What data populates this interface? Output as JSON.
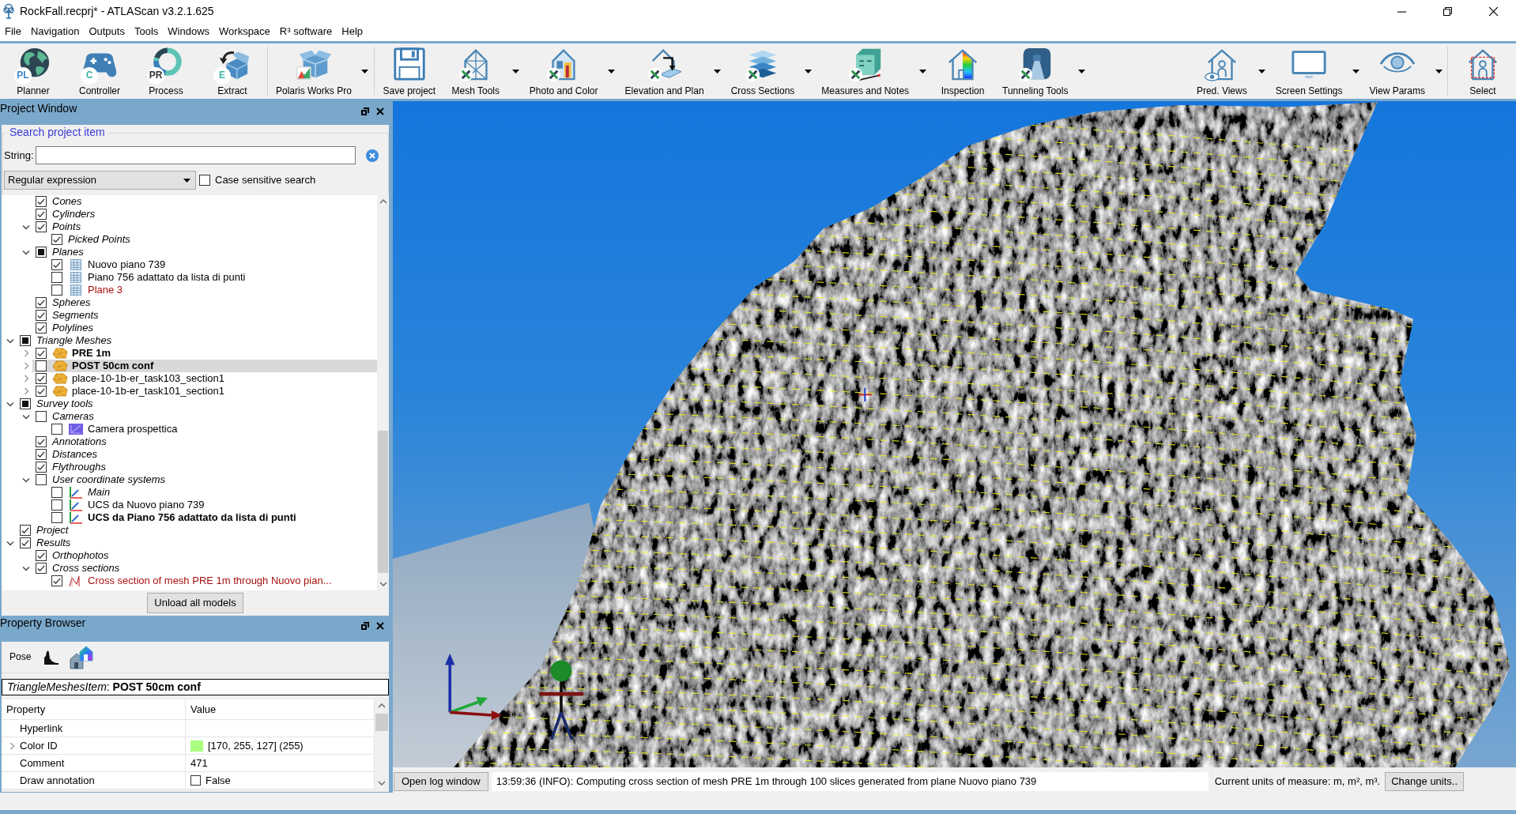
{
  "window": {
    "title": "RockFall.recprj* - ATLAScan v3.2.1.625"
  },
  "menu": [
    "File",
    "Navigation",
    "Outputs",
    "Tools",
    "Windows",
    "Workspace",
    "R³ software",
    "Help"
  ],
  "toolbar": {
    "left_groups": [
      {
        "items": [
          {
            "label": "Planner",
            "kind": "planner",
            "badge": "PL",
            "dropdown": false
          },
          {
            "label": "Controller",
            "kind": "controller",
            "badge": "C",
            "dropdown": false
          },
          {
            "label": "Process",
            "kind": "process",
            "badge": "PR",
            "dropdown": false
          },
          {
            "label": "Extract",
            "kind": "extract",
            "badge": "E",
            "dropdown": false
          }
        ]
      },
      {
        "items": [
          {
            "label": "Polaris Works Pro",
            "kind": "polaris",
            "dropdown": true
          }
        ]
      },
      {
        "items": [
          {
            "label": "Save project",
            "kind": "save",
            "dropdown": false
          },
          {
            "label": "Mesh Tools",
            "kind": "mesh",
            "dropdown": true
          },
          {
            "label": "Photo and Color",
            "kind": "photo",
            "dropdown": true
          },
          {
            "label": "Elevation and Plan",
            "kind": "elevation",
            "dropdown": true
          },
          {
            "label": "Cross Sections",
            "kind": "sections",
            "dropdown": true
          },
          {
            "label": "Measures and Notes",
            "kind": "measures",
            "dropdown": true
          },
          {
            "label": "Inspection",
            "kind": "inspection",
            "dropdown": false
          },
          {
            "label": "Tunneling Tools",
            "kind": "tunneling",
            "dropdown": true
          }
        ]
      }
    ],
    "right_groups": [
      {
        "items": [
          {
            "label": "Pred. Views",
            "kind": "predviews",
            "dropdown": true
          },
          {
            "label": "Screen Settings",
            "kind": "screen",
            "dropdown": true
          },
          {
            "label": "View Params",
            "kind": "viewparams",
            "dropdown": true
          }
        ]
      },
      {
        "items": [
          {
            "label": "Select",
            "kind": "select",
            "dropdown": false
          }
        ]
      }
    ]
  },
  "project_window": {
    "title": "Project Window",
    "search": {
      "title": "Search project item",
      "string_label": "String:",
      "mode": "Regular expression",
      "case_sensitive": {
        "label": "Case sensitive search",
        "checked": false
      }
    },
    "tree": [
      {
        "children": [
          {
            "label": "Cones",
            "italic": true,
            "checked": true,
            "selected": false
          },
          {
            "label": "Cylinders",
            "italic": true,
            "checked": true,
            "selected": false
          },
          {
            "label": "Points",
            "italic": true,
            "checked": true,
            "selected": false,
            "expanded": true,
            "children": [
              {
                "label": "Picked Points",
                "italic": true,
                "checked": true,
                "selected": false
              }
            ]
          },
          {
            "label": "Planes",
            "italic": true,
            "checked": false,
            "partial": true,
            "selected": false,
            "expanded": true,
            "children": [
              {
                "label": "Nuovo piano 739",
                "kind": "plane",
                "checked": true,
                "selected": false
              },
              {
                "label": "Piano 756 adattato da lista di punti",
                "kind": "plane",
                "checked": false,
                "selected": false
              },
              {
                "label": "Plane 3",
                "kind": "plane",
                "color": "#a81010",
                "checked": false,
                "selected": false
              }
            ]
          },
          {
            "label": "Spheres",
            "italic": true,
            "checked": true,
            "selected": false
          },
          {
            "label": "Segments",
            "italic": true,
            "checked": true,
            "selected": false
          },
          {
            "label": "Polylines",
            "italic": true,
            "checked": true,
            "selected": false
          }
        ]
      },
      {
        "label": "Triangle Meshes",
        "italic": true,
        "checked": false,
        "partial": true,
        "selected": false,
        "expanded": true,
        "children": [
          {
            "label": "PRE 1m",
            "kind": "mesh",
            "bold": true,
            "checked": true,
            "selected": false,
            "expanded": false
          },
          {
            "label": "POST 50cm conf",
            "kind": "mesh",
            "bold": true,
            "checked": false,
            "selected": true,
            "expanded": false
          },
          {
            "label": "place-10-1b-er_task103_section1",
            "kind": "mesh",
            "checked": true,
            "selected": false,
            "expanded": false
          },
          {
            "label": "place-10-1b-er_task101_section1",
            "kind": "mesh",
            "checked": true,
            "selected": false,
            "expanded": false
          }
        ]
      },
      {
        "label": "Survey tools",
        "italic": true,
        "checked": false,
        "partial": true,
        "selected": false,
        "expanded": true,
        "children": [
          {
            "label": "Cameras",
            "italic": true,
            "checked": false,
            "selected": false,
            "expanded": true,
            "children": [
              {
                "label": "Camera prospettica",
                "kind": "camera",
                "checked": false,
                "selected": false
              }
            ]
          },
          {
            "label": "Annotations",
            "italic": true,
            "checked": true,
            "selected": false
          },
          {
            "label": "Distances",
            "italic": true,
            "checked": true,
            "selected": false
          },
          {
            "label": "Flythroughs",
            "italic": true,
            "checked": true,
            "selected": false
          },
          {
            "label": "User coordinate systems",
            "italic": true,
            "checked": false,
            "selected": false,
            "expanded": true,
            "children": [
              {
                "label": "Main",
                "kind": "ucs",
                "italic": true,
                "checked": false,
                "selected": false
              },
              {
                "label": "UCS da Nuovo piano 739",
                "kind": "ucs",
                "checked": false,
                "selected": false
              },
              {
                "label": "UCS da Piano 756 adattato da lista di punti",
                "kind": "ucs",
                "bold": true,
                "checked": false,
                "selected": false
              }
            ]
          }
        ]
      },
      {
        "label": "Project",
        "italic": true,
        "checked": true,
        "selected": false
      },
      {
        "label": "Results",
        "italic": true,
        "checked": true,
        "selected": false,
        "expanded": true,
        "children": [
          {
            "label": "Orthophotos",
            "italic": true,
            "checked": true,
            "selected": false
          },
          {
            "label": "Cross sections",
            "italic": true,
            "checked": true,
            "selected": false,
            "expanded": true,
            "children": [
              {
                "label": "Cross section of mesh PRE 1m through Nuovo pian...",
                "kind": "section",
                "color": "#a81010",
                "checked": true,
                "selected": false
              }
            ]
          }
        ]
      }
    ],
    "unload_button": "Unload all models"
  },
  "property_browser": {
    "title": "Property Browser",
    "tools": [
      {
        "kind": "text",
        "label": "Pose"
      },
      {
        "kind": "histogram"
      },
      {
        "kind": "houses"
      }
    ],
    "item_title": "*TriangleMeshesItem*: **POST 50cm conf**",
    "columns": [
      "Property",
      "Value"
    ],
    "rows": [
      {
        "kind": "text",
        "name": "Hyperlink"
      },
      {
        "kind": "color",
        "name": "Color ID",
        "expanded": false,
        "color": "#aaff7f",
        "value": "[170, 255, 127] (255)"
      },
      {
        "kind": "text",
        "name": "Comment",
        "value": "471"
      },
      {
        "kind": "bool",
        "name": "Draw annotation",
        "checked": false,
        "value": "False"
      }
    ]
  },
  "status_bar": {
    "log_button": "Open log window",
    "message": "13:59:36 (INFO): Computing cross section of mesh PRE 1m through 100 slices generated from plane Nuovo piano 739",
    "units": "Current units of measure: m, m², m³.",
    "units_button": "Change units.."
  }
}
